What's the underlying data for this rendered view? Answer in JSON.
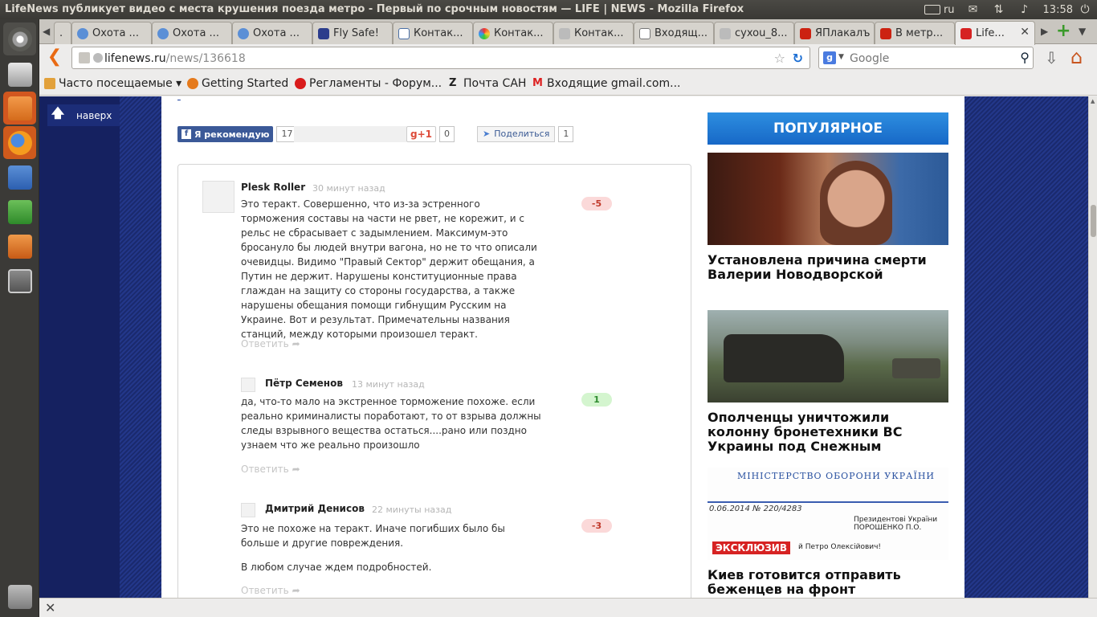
{
  "window": {
    "title": "LifeNews публикует видео с места крушения поезда метро - Первый по срочным новостям — LIFE | NEWS - Mozilla Firefox"
  },
  "tray": {
    "lang": "ru",
    "clock": "13:58"
  },
  "tabs": [
    {
      "label": "."
    },
    {
      "label": "Охота ..."
    },
    {
      "label": "Охота ..."
    },
    {
      "label": "Охота ..."
    },
    {
      "label": "Fly Safe!"
    },
    {
      "label": "Контак..."
    },
    {
      "label": "Контак..."
    },
    {
      "label": "Контак..."
    },
    {
      "label": "Входящ..."
    },
    {
      "label": "cyxou_8..."
    },
    {
      "label": "ЯПлакалъ"
    },
    {
      "label": "В метр..."
    },
    {
      "label": "Life..."
    }
  ],
  "nav": {
    "url_domain": "lifenews.ru",
    "url_path": "/news/136618",
    "search_engine": "Google"
  },
  "bookmarks": [
    {
      "label": "Часто посещаемые ▾"
    },
    {
      "label": "Getting Started"
    },
    {
      "label": "Регламенты - Форум..."
    },
    {
      "label": "Почта САН"
    },
    {
      "label": "Входящие gmail.com..."
    }
  ],
  "page": {
    "top_link": "наверх",
    "social": {
      "fb_label": "Я рекомендую",
      "fb_count": "17",
      "gplus_label": "+1",
      "gplus_count": "0",
      "share_label": "Поделиться",
      "share_count": "1"
    },
    "reply_label": "Ответить",
    "comments": [
      {
        "author": "Plesk Roller",
        "time": "30 минут назад",
        "text": "Это теракт. Совершенно, что из-за эстренного торможения составы на части не рвет, не корежит, и с рельс не сбрасывает с задымлением. Максимум-это бросануло бы людей внутри вагона, но не то что описали очевидцы. Видимо \"Правый Сектор\" держит обещания, а Путин не держит. Нарушены конституционные права глаждан на защиту со стороны государства, а также нарушены обещания помощи гибнущим Русским на Украине. Вот и результат. Примечательны названия станций, между которыми произошел теракт.",
        "rating": "-5"
      },
      {
        "author": "Пётр Семенов",
        "time": "13 минут назад",
        "text": "да, что-то мало на экстренное торможение похоже. если реально криминалисты поработают, то от взрыва должны следы взрывного вещества остаться....рано или поздно узнаем что же реально произошло",
        "rating": "1"
      },
      {
        "author": "Дмитрий Денисов",
        "time": "22 минуты назад",
        "text": "Это не похоже на теракт. Иначе погибших было бы больше и другие повреждения.",
        "text2": "В любом случае ждем подробностей.",
        "rating": "-3"
      }
    ],
    "sidebar": {
      "title": "ПОПУЛЯРНОЕ",
      "news": [
        {
          "headline": "Установлена причина смерти Валерии Новодворской"
        },
        {
          "headline": "Ополченцы уничтожили колонну бронетехники ВС Украины под Снежным"
        },
        {
          "headline": "Киев готовится отправить беженцев на фронт",
          "badge": "ЭКСКЛЮЗИВ",
          "doc_title": "МІНІСТЕРСТВО ОБОРОНИ УКРАЇНИ",
          "doc_to": "Президентові України ПОРОШЕНКО П.О.",
          "doc_greet": "й Петро Олексійович!",
          "doc_num": "0.06.2014 № 220/4283"
        }
      ]
    }
  },
  "colors": {
    "accent": "#e96a13",
    "nav_blue": "#1c2d78",
    "pop_blue": "#1f7ad4",
    "negative": "#c0392b",
    "positive": "#2e8b2e"
  }
}
